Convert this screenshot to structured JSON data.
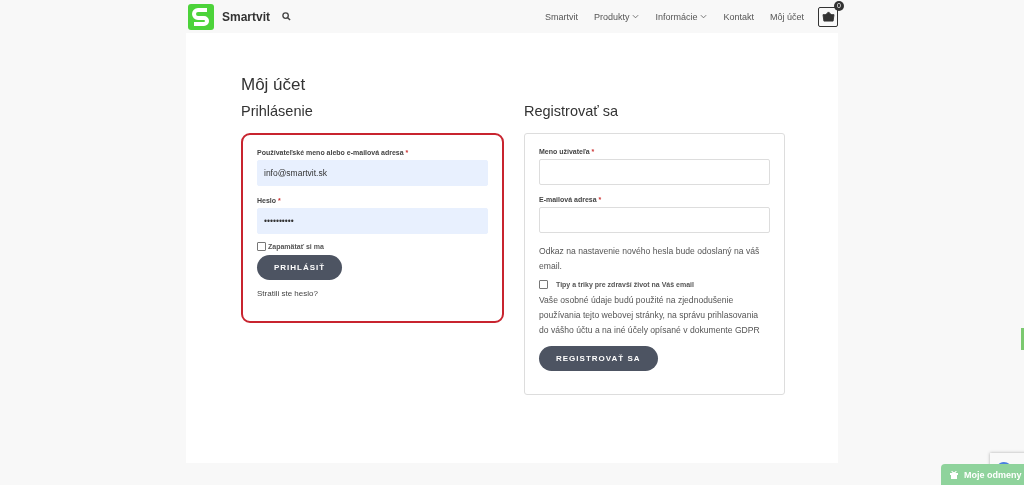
{
  "header": {
    "logo_text": "Smartvit",
    "nav": [
      {
        "label": "Smartvit",
        "dropdown": false
      },
      {
        "label": "Produkty",
        "dropdown": true
      },
      {
        "label": "Informácie",
        "dropdown": true
      },
      {
        "label": "Kontakt",
        "dropdown": false
      },
      {
        "label": "Môj účet",
        "dropdown": false
      }
    ],
    "cart_count": "0"
  },
  "page_title": "Môj účet",
  "login": {
    "heading": "Prihlásenie",
    "highlighted": true,
    "fields": [
      {
        "label": "Používateľské meno alebo e-mailová adresa",
        "required_mark": "*",
        "value": "info@smartvit.sk"
      },
      {
        "label": "Heslo",
        "required_mark": "*",
        "value": "••••••••••"
      }
    ],
    "remember": {
      "label": "Zapamätať si ma",
      "checked": false
    },
    "button": "PRIHLÁSIŤ",
    "lost_password": "Stratili ste heslo?"
  },
  "register": {
    "heading": "Registrovať sa",
    "fields": [
      {
        "label": "Meno užívateľa",
        "required_mark": "*"
      },
      {
        "label": "E-mailová adresa",
        "required_mark": "*"
      }
    ],
    "note": "Odkaz na nastavenie nového hesla bude odoslaný na váš email.",
    "newsletter": {
      "label": "Tipy a triky pre zdravší život na Váš email",
      "checked": false
    },
    "privacy": "Vaše osobné údaje budú použité na zjednodušenie používania tejto webovej stránky, na správu prihlasovania do vášho účtu a na iné účely opísané v dokumente GDPR",
    "button": "REGISTROVAŤ SA"
  },
  "rewards_button": "Moje odmeny"
}
